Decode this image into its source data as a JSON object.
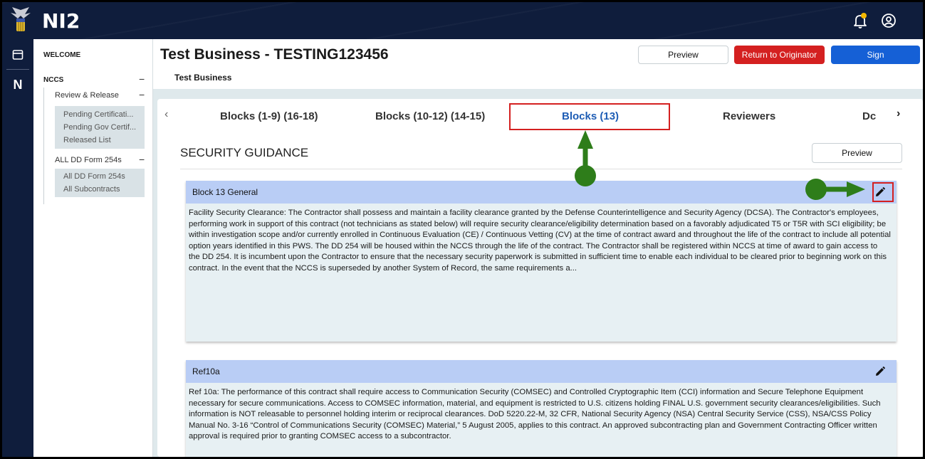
{
  "app": {
    "title": "NI2"
  },
  "sidebar": {
    "welcome": "WELCOME",
    "nccs": "NCCS",
    "review_release": "Review & Release",
    "review_links": [
      "Pending Certificati...",
      "Pending Gov Certif...",
      "Released List"
    ],
    "all_forms": "ALL DD Form 254s",
    "all_links": [
      "All DD Form 254s",
      "All Subcontracts"
    ]
  },
  "header": {
    "title": "Test Business - TESTING123456",
    "subtitle": "Test Business",
    "preview_label": "Preview",
    "return_label": "Return to Originator",
    "sign_label": "Sign"
  },
  "tabs": [
    {
      "label": "Blocks (1-9) (16-18)",
      "active": false
    },
    {
      "label": "Blocks (10-12) (14-15)",
      "active": false
    },
    {
      "label": "Blocks (13)",
      "active": true
    },
    {
      "label": "Reviewers",
      "active": false
    },
    {
      "label": "Dc",
      "active": false
    }
  ],
  "section": {
    "title": "SECURITY GUIDANCE",
    "preview_label": "Preview"
  },
  "blocks": [
    {
      "title": "Block 13 General",
      "text": "Facility Security Clearance: The Contractor shall possess and maintain a facility clearance granted by the Defense Counterintelligence and Security Agency (DCSA). The Contractor's employees, performing work in support of this contract (not technicians as stated below) will require security clearance/eligibility determination based on a favorably adjudicated T5 or T5R with SCI eligibility; be within investigation scope and/or currently enrolled in Continuous Evaluation (CE) / Continuous Vetting (CV) at the time of contract award and throughout the life of the contract to include all potential option years identified in this PWS. The DD 254 will be housed within the NCCS through the life of the contract. The Contractor shall be registered within NCCS at time of award to gain access to the DD 254. It is incumbent upon the Contractor to ensure that the necessary security paperwork is submitted in sufficient time to enable each individual to be cleared prior to beginning work on this contract. In the event that the NCCS is superseded by another System of Record, the same requirements a..."
    },
    {
      "title": "Ref10a",
      "text": "Ref 10a: The performance of this contract shall require access to Communication Security (COMSEC) and Controlled Cryptographic Item (CCI) information and Secure Telephone Equipment necessary for secure communications. Access to COMSEC information, material, and equipment is restricted to U.S. citizens holding FINAL U.S. government security clearances/eligibilities. Such information is NOT releasable to personnel holding interim or reciprocal clearances. DoD 5220.22-M, 32 CFR, National Security Agency (NSA) Central Security Service (CSS), NSA/CSS Policy Manual No. 3-16 “Control of Communications Security (COMSEC) Material,” 5 August 2005, applies to this contract. An approved subcontracting plan and Government Contracting Officer written approval is required prior to granting COMSEC access to a subcontractor."
    }
  ],
  "colors": {
    "nav_bg": "#0f1d3c",
    "accent_blue": "#1560d6",
    "danger_red": "#d42020",
    "active_tab": "#1e5db5",
    "block_header": "#b9cdf5",
    "annotation_green": "#2e7d1a",
    "notification_dot": "#f5b800"
  },
  "icons": [
    "eagle-logo-icon",
    "bell-icon",
    "user-circle-icon",
    "window-icon",
    "chevron-left-icon",
    "chevron-right-icon",
    "pencil-icon",
    "minus-icon"
  ]
}
